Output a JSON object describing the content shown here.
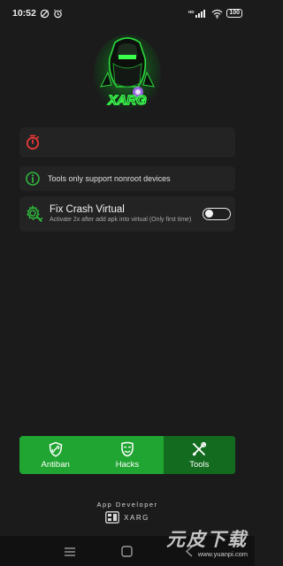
{
  "status_bar": {
    "time": "10:52",
    "network_label": "HD",
    "battery": "100"
  },
  "logo": {
    "text": "XARG"
  },
  "info_card": {
    "text": "Tools only support nonroot devices"
  },
  "fix_card": {
    "title": "Fix Crash Virtual",
    "description": "Activate 2x after add apk into virtual (Only first time)",
    "toggle_on": false
  },
  "bottom_nav": {
    "items": [
      {
        "label": "Antiban",
        "icon": "shield-link-icon"
      },
      {
        "label": "Hacks",
        "icon": "mask-icon"
      },
      {
        "label": "Tools",
        "icon": "tools-icon"
      }
    ],
    "active": "Tools"
  },
  "developer": {
    "title": "App Developer",
    "brand": "XARG"
  },
  "watermark": {
    "main": "元皮下载",
    "sub": "www.yuanpi.com"
  },
  "colors": {
    "accent_green": "#21a532",
    "active_green": "#126b1e",
    "error_red": "#e53935",
    "info_green": "#2fb53a"
  }
}
